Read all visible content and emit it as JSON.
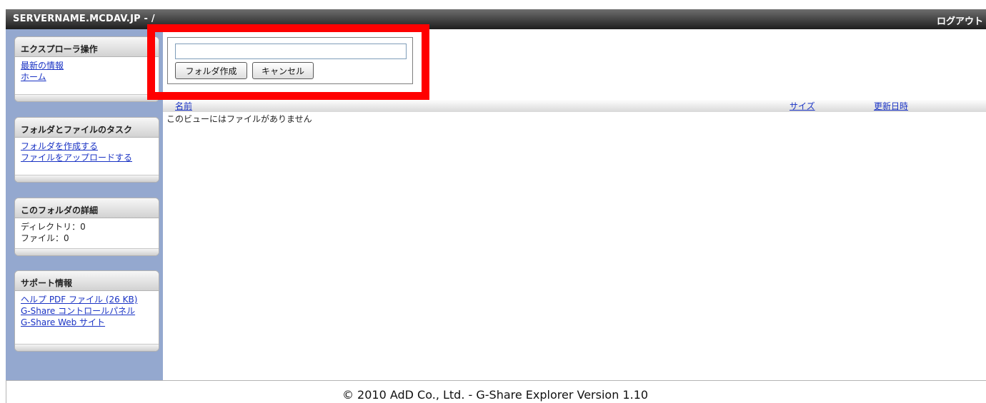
{
  "header": {
    "title": "SERVERNAME.MCDAV.JP - /",
    "logout": "ログアウト"
  },
  "sidebar": {
    "explorer": {
      "heading": "エクスプローラ操作",
      "links": [
        "最新の情報",
        "ホーム"
      ]
    },
    "tasks": {
      "heading": "フォルダとファイルのタスク",
      "links": [
        "フォルダを作成する",
        "ファイルをアップロードする"
      ]
    },
    "details": {
      "heading": "このフォルダの詳細",
      "lines": [
        "ディレクトリ：0",
        "ファイル：0"
      ]
    },
    "support": {
      "heading": "サポート情報",
      "links": [
        "ヘルプ PDF ファイル (26 KB)",
        "G-Share コントロールパネル",
        "G-Share Web サイト"
      ]
    }
  },
  "folder_form": {
    "input_value": "",
    "create_label": "フォルダ作成",
    "cancel_label": "キャンセル"
  },
  "file_list": {
    "columns": [
      "名前",
      "サイズ",
      "更新日時"
    ],
    "empty_message": "このビューにはファイルがありません"
  },
  "footer": {
    "text": "© 2010 AdD Co., Ltd. - G-Share Explorer Version 1.10"
  },
  "colors": {
    "sidebar_bg": "#94a8cf",
    "link": "#1a33c4",
    "highlight": "#ff0000"
  }
}
